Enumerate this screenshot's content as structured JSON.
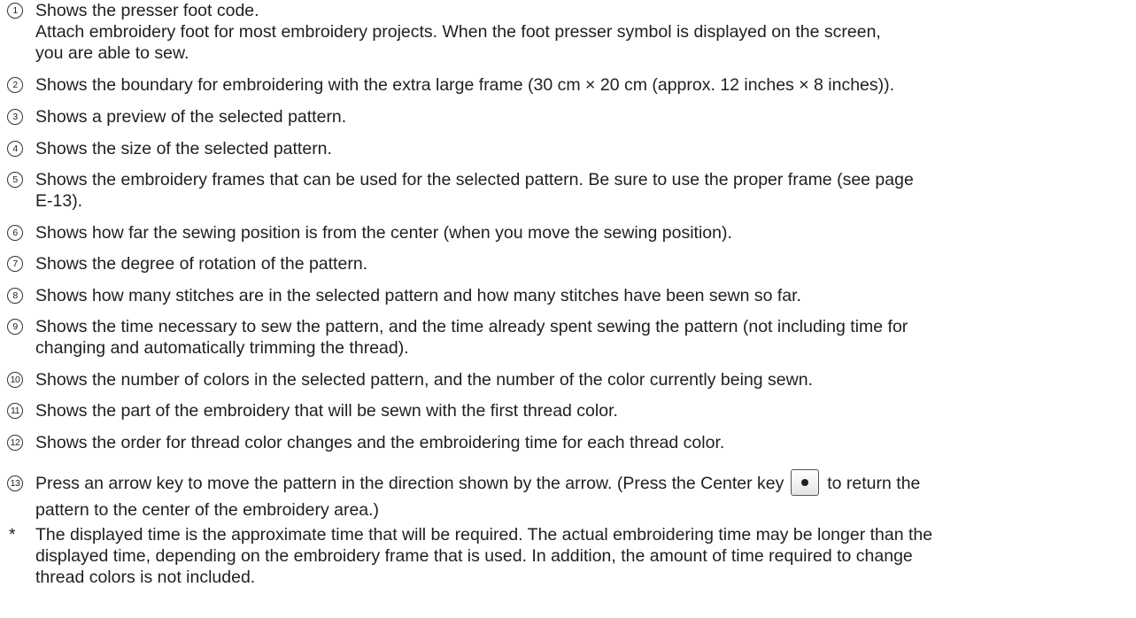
{
  "items": [
    {
      "num": "1",
      "lines": [
        "Shows the presser foot code.",
        "Attach embroidery foot for most embroidery projects. When the foot presser symbol is displayed on the screen,",
        "you are able to sew."
      ]
    },
    {
      "num": "2",
      "lines": [
        "Shows the boundary for embroidering with the extra large frame (30 cm × 20 cm (approx. 12 inches × 8 inches))."
      ]
    },
    {
      "num": "3",
      "lines": [
        "Shows a preview of the selected pattern."
      ]
    },
    {
      "num": "4",
      "lines": [
        "Shows the size of the selected pattern."
      ]
    },
    {
      "num": "5",
      "lines": [
        "Shows the embroidery frames that can be used for the selected pattern. Be sure to use the proper frame (see page",
        "E-13)."
      ]
    },
    {
      "num": "6",
      "lines": [
        "Shows how far the sewing position is from the center (when you move the sewing position)."
      ]
    },
    {
      "num": "7",
      "lines": [
        "Shows the degree of rotation of the pattern."
      ]
    },
    {
      "num": "8",
      "lines": [
        "Shows how many stitches are in the selected pattern and how many stitches have been sewn so far."
      ]
    },
    {
      "num": "9",
      "lines": [
        "Shows the time necessary to sew the pattern, and the time already spent sewing the pattern (not including time for",
        "changing and automatically trimming the thread)."
      ]
    },
    {
      "num": "10",
      "lines": [
        "Shows the number of colors in the selected pattern, and the number of the color currently being sewn."
      ]
    },
    {
      "num": "11",
      "lines": [
        "Shows the part of the embroidery that will be sewn with the first thread color."
      ]
    },
    {
      "num": "12",
      "lines": [
        "Shows the order for thread color changes and the embroidering time for each thread color."
      ]
    },
    {
      "num": "13",
      "before_key": "Press an arrow key to move the pattern in the direction shown by the arrow. (Press the Center key",
      "after_key": "to return the",
      "line2": "pattern to the center of the embroidery area.)"
    }
  ],
  "note": {
    "marker": "*",
    "lines": [
      "The displayed time is the approximate time that will be required. The actual embroidering time may be longer than the",
      "displayed time, depending on the embroidery frame that is used. In addition, the amount of time required to change",
      "thread colors is not included."
    ]
  }
}
